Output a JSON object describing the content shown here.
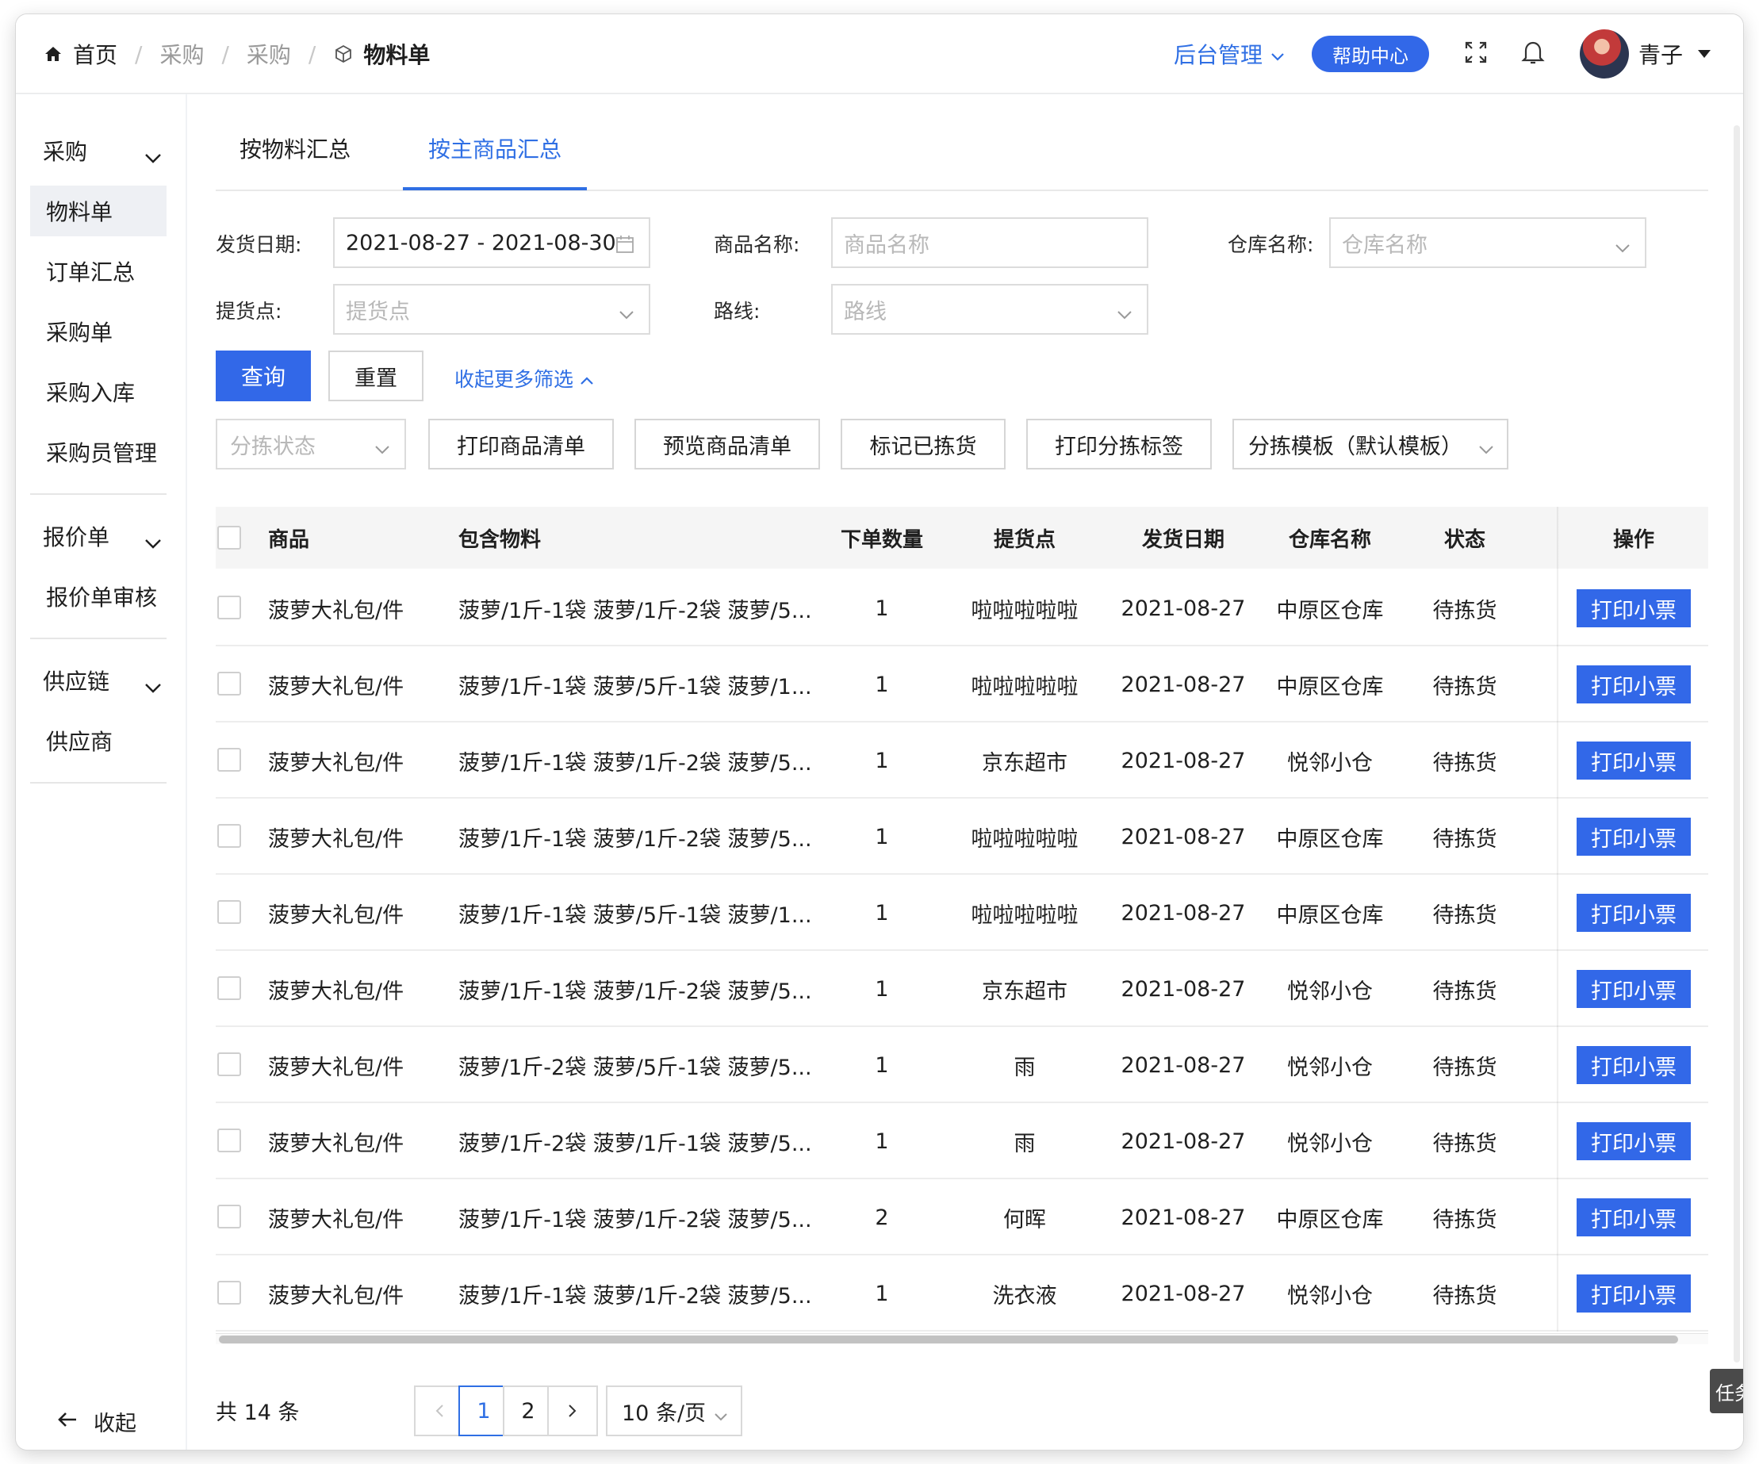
{
  "breadcrumb": {
    "home": "首页",
    "level1": "采购",
    "level2": "采购",
    "current": "物料单"
  },
  "header": {
    "admin": "后台管理",
    "help": "帮助中心",
    "user": "青子"
  },
  "sidebar": {
    "group1": "采购",
    "items1": [
      "物料单",
      "订单汇总",
      "采购单",
      "采购入库",
      "采购员管理"
    ],
    "group2": "报价单",
    "items2": [
      "报价单审核"
    ],
    "group3": "供应链",
    "items3": [
      "供应商"
    ],
    "collapse": "收起"
  },
  "tabs": [
    "按物料汇总",
    "按主商品汇总"
  ],
  "filters": {
    "ship_date_label": "发货日期:",
    "ship_date_value": "2021-08-27 - 2021-08-30",
    "product_label": "商品名称:",
    "product_placeholder": "商品名称",
    "warehouse_label": "仓库名称:",
    "warehouse_placeholder": "仓库名称",
    "pickup_label": "提货点:",
    "pickup_placeholder": "提货点",
    "route_label": "路线:",
    "route_placeholder": "路线",
    "query": "查询",
    "reset": "重置",
    "collapse_more": "收起更多筛选"
  },
  "toolbar": {
    "sort_status_placeholder": "分拣状态",
    "print_list": "打印商品清单",
    "preview_list": "预览商品清单",
    "mark_picked": "标记已拣货",
    "print_labels": "打印分拣标签",
    "template": "分拣模板（默认模板）"
  },
  "table": {
    "columns": [
      "商品",
      "包含物料",
      "下单数量",
      "提货点",
      "发货日期",
      "仓库名称",
      "状态",
      "操作"
    ],
    "action_label": "打印小票",
    "rows": [
      [
        "菠萝大礼包/件",
        "菠萝/1斤-1袋 菠萝/1斤-2袋 菠萝/5...",
        "1",
        "啦啦啦啦啦",
        "2021-08-27",
        "中原区仓库",
        "待拣货"
      ],
      [
        "菠萝大礼包/件",
        "菠萝/1斤-1袋 菠萝/5斤-1袋 菠萝/1...",
        "1",
        "啦啦啦啦啦",
        "2021-08-27",
        "中原区仓库",
        "待拣货"
      ],
      [
        "菠萝大礼包/件",
        "菠萝/1斤-1袋 菠萝/1斤-2袋 菠萝/5...",
        "1",
        "京东超市",
        "2021-08-27",
        "悦邻小仓",
        "待拣货"
      ],
      [
        "菠萝大礼包/件",
        "菠萝/1斤-1袋 菠萝/1斤-2袋 菠萝/5...",
        "1",
        "啦啦啦啦啦",
        "2021-08-27",
        "中原区仓库",
        "待拣货"
      ],
      [
        "菠萝大礼包/件",
        "菠萝/1斤-1袋 菠萝/5斤-1袋 菠萝/1...",
        "1",
        "啦啦啦啦啦",
        "2021-08-27",
        "中原区仓库",
        "待拣货"
      ],
      [
        "菠萝大礼包/件",
        "菠萝/1斤-1袋 菠萝/1斤-2袋 菠萝/5...",
        "1",
        "京东超市",
        "2021-08-27",
        "悦邻小仓",
        "待拣货"
      ],
      [
        "菠萝大礼包/件",
        "菠萝/1斤-2袋 菠萝/5斤-1袋 菠萝/5...",
        "1",
        "雨",
        "2021-08-27",
        "悦邻小仓",
        "待拣货"
      ],
      [
        "菠萝大礼包/件",
        "菠萝/1斤-2袋 菠萝/1斤-1袋 菠萝/5...",
        "1",
        "雨",
        "2021-08-27",
        "悦邻小仓",
        "待拣货"
      ],
      [
        "菠萝大礼包/件",
        "菠萝/1斤-1袋 菠萝/1斤-2袋 菠萝/5...",
        "2",
        "何晖",
        "2021-08-27",
        "中原区仓库",
        "待拣货"
      ],
      [
        "菠萝大礼包/件",
        "菠萝/1斤-1袋 菠萝/1斤-2袋 菠萝/5...",
        "1",
        "洗衣液",
        "2021-08-27",
        "悦邻小仓",
        "待拣货"
      ]
    ]
  },
  "pagination": {
    "total": "共 14 条",
    "pages": [
      "1",
      "2"
    ],
    "page_size": "10 条/页"
  },
  "task_tab": "任务",
  "colors": {
    "primary": "#3268e8",
    "link": "#2f6fe4"
  }
}
